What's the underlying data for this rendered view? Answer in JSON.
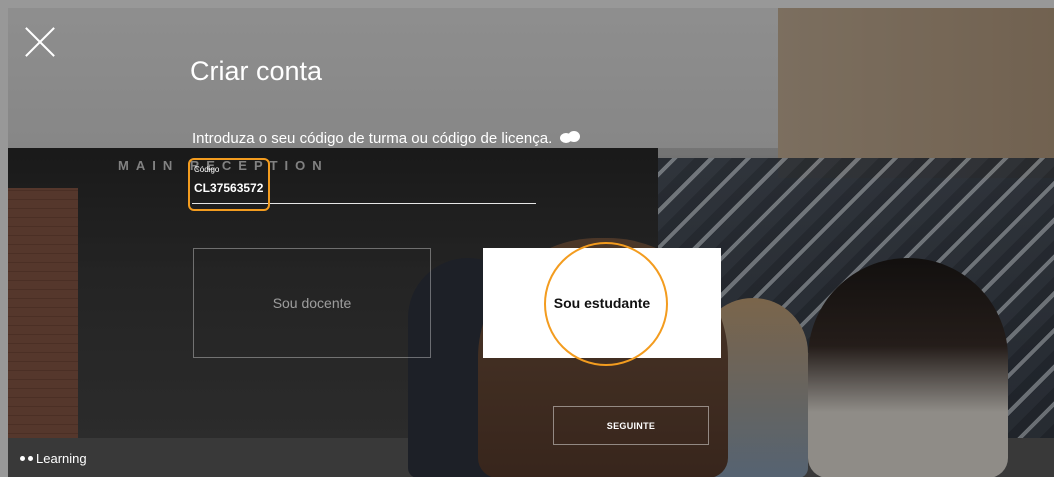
{
  "title": "Criar conta",
  "intro_text": "Introduza o seu código de turma ou código de licença.",
  "code_field": {
    "label": "Código",
    "value": "CL37563572"
  },
  "background_sign": "MAIN RECEPTION",
  "choices": {
    "teacher_label": "Sou docente",
    "student_label": "Sou estudante",
    "selected": "student"
  },
  "next_button_label": "SEGUINTE",
  "brand_text": "Learning",
  "icons": {
    "close": "close-icon",
    "help": "chat-help-icon",
    "brand": "brand-dots-icon"
  },
  "colors": {
    "highlight": "#f39c1f",
    "selected_bg": "#ffffff"
  }
}
